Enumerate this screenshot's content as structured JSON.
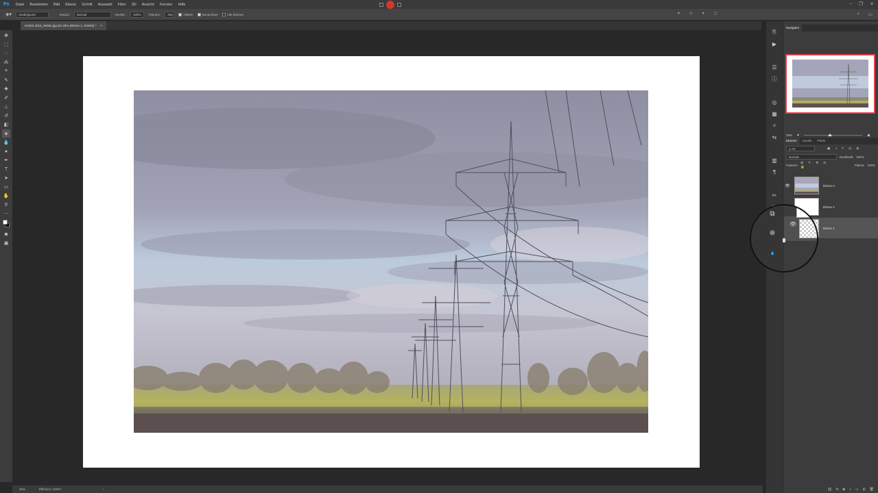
{
  "app": {
    "logo": "Ps"
  },
  "menu": [
    "Datei",
    "Bearbeiten",
    "Bild",
    "Ebene",
    "Schrift",
    "Auswahl",
    "Filter",
    "3D",
    "Ansicht",
    "Fenster",
    "Hilfe"
  ],
  "options": {
    "source": "Vordergrund",
    "mode_label": "Modus:",
    "mode_value": "Normal",
    "opacity_label": "Deckkr.:",
    "opacity_value": "100%",
    "tolerance_label": "Toleranz:",
    "tolerance_value": "255",
    "smoothing_label": "Glätten",
    "contiguous_label": "Benachbart",
    "all_layers_label": "Alle Ebenen"
  },
  "document": {
    "tab_title": "Herbst 2016_06082.jpg bei 25% (Ebene 1, RGB/8) *",
    "close": "×"
  },
  "status": {
    "zoom": "25%",
    "efficiency": "Effizienz: 100%*",
    "arrow": "›"
  },
  "navigator": {
    "tab": "Navigator",
    "zoom": "25%"
  },
  "layers_panel": {
    "tabs": [
      "Ebenen",
      "Kanäle",
      "Pfade"
    ],
    "filter": "ρ Art",
    "blend_mode": "Normal",
    "opacity_label": "Deckkraft:",
    "opacity_value": "100%",
    "lock_label": "Fixieren:",
    "fill_label": "Fläche:",
    "fill_value": "100%",
    "layers": [
      {
        "name": "Ebene 0",
        "visible": true
      },
      {
        "name": "Ebene 2",
        "visible": false
      },
      {
        "name": "Ebene 1",
        "visible": true,
        "selected": true
      }
    ]
  },
  "colors": {
    "accent": "#31a8ff",
    "record": "#d0392b",
    "nav_frame": "#e0424b"
  }
}
